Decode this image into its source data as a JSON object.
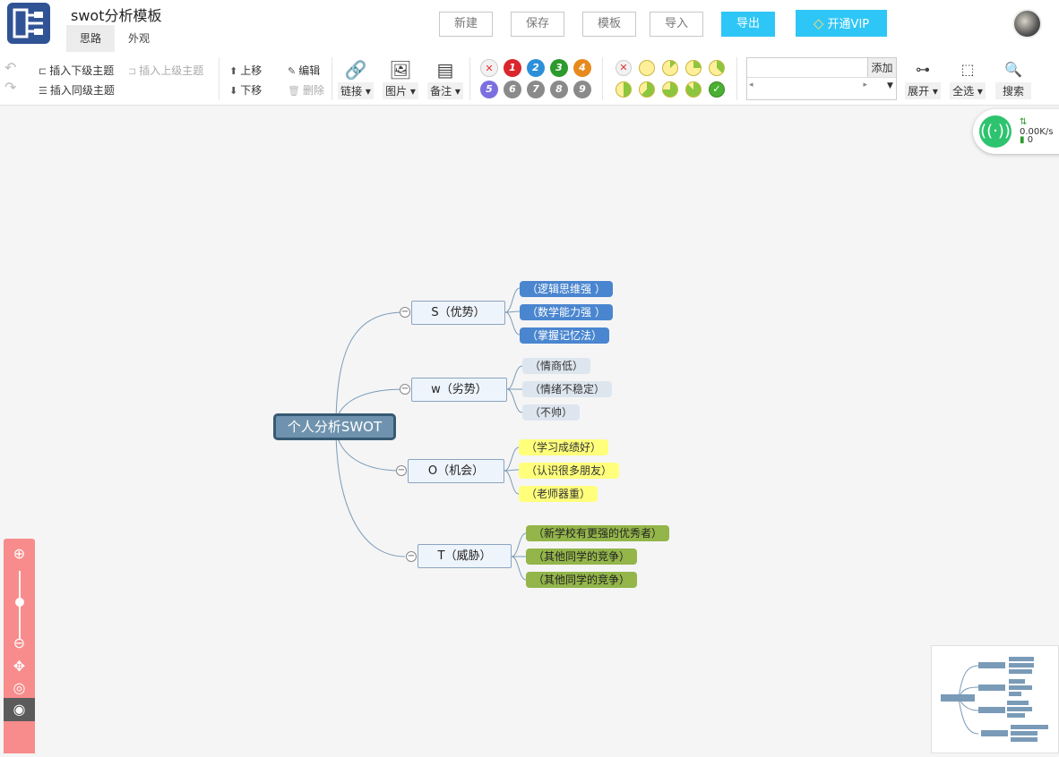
{
  "app": {
    "title": "swot分析模板"
  },
  "tabs": [
    {
      "label": "思路"
    },
    {
      "label": "外观"
    }
  ],
  "top_buttons": {
    "new": "新建",
    "save": "保存",
    "template": "模板",
    "import": "导入",
    "export": "导出",
    "vip": "开通VIP"
  },
  "toolbar": {
    "insert_child": "插入下级主题",
    "insert_parent": "插入上级主题",
    "insert_sibling": "插入同级主题",
    "move_up": "上移",
    "move_down": "下移",
    "edit": "编辑",
    "delete": "删除",
    "link": "链接",
    "image": "图片",
    "note": "备注",
    "add": "添加",
    "expand": "展开",
    "select_all": "全选",
    "search": "搜索"
  },
  "priorities": [
    {
      "label": "1",
      "color": "#d9262c"
    },
    {
      "label": "2",
      "color": "#2e8fd9"
    },
    {
      "label": "3",
      "color": "#2c9a2c"
    },
    {
      "label": "4",
      "color": "#e78a1e"
    },
    {
      "label": "5",
      "color": "#7b6fe0"
    },
    {
      "label": "6",
      "color": "#8a8a8a"
    },
    {
      "label": "7",
      "color": "#8a8a8a"
    },
    {
      "label": "8",
      "color": "#8a8a8a"
    },
    {
      "label": "9",
      "color": "#8a8a8a"
    }
  ],
  "network": {
    "speed": "0.00K/s",
    "count": "0"
  },
  "mindmap": {
    "root": "个人分析SWOT",
    "branches": [
      {
        "label": "S（优势）",
        "leaves": [
          "（逻辑思维强 ）",
          "（数学能力强 ）",
          "（掌握记忆法）"
        ]
      },
      {
        "label": "w（劣势）",
        "leaves": [
          "（情商低）",
          "（情绪不稳定）",
          "（不帅）"
        ]
      },
      {
        "label": "O（机会）",
        "leaves": [
          "（学习成绩好）",
          "（认识很多朋友）",
          "（老师器重）"
        ]
      },
      {
        "label": "T（威胁）",
        "leaves": [
          "（新学校有更强的优秀者）",
          "（其他同学的竞争）",
          "（其他同学的竞争）"
        ]
      }
    ]
  },
  "colors": {
    "accent": "#2ec6f6",
    "logo": "#2f5394",
    "root_fill": "#6f93ae",
    "leaf_s": "#4a86cf",
    "leaf_w": "#dde6ef",
    "leaf_o": "#ffff7c",
    "leaf_t": "#93b54a",
    "zoom_panel": "#f88c8c",
    "wifi": "#2ec36f"
  }
}
